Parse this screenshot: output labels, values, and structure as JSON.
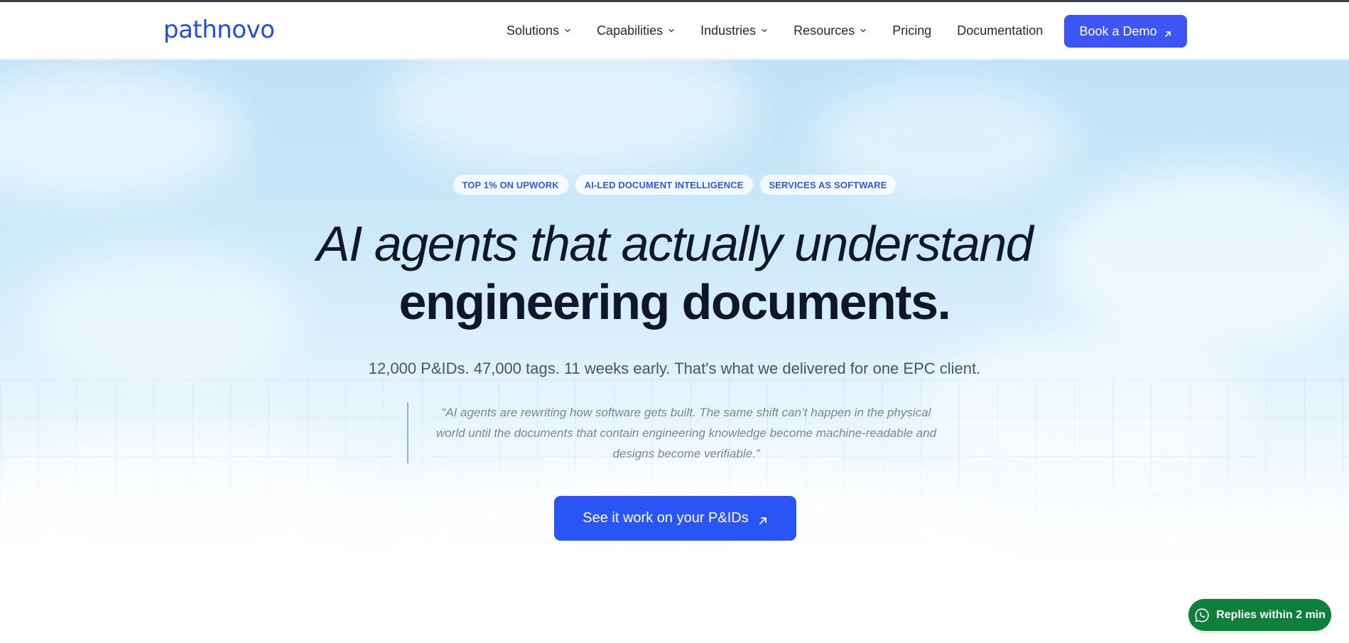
{
  "brand": {
    "logo_text": "pathnovo",
    "accent": "#3e55f5",
    "cta_color": "#2a55f5",
    "whatsapp_color": "#0f7f3c"
  },
  "nav": {
    "items": [
      {
        "label": "Solutions",
        "has_dropdown": true
      },
      {
        "label": "Capabilities",
        "has_dropdown": true
      },
      {
        "label": "Industries",
        "has_dropdown": true
      },
      {
        "label": "Resources",
        "has_dropdown": true
      },
      {
        "label": "Pricing",
        "has_dropdown": false
      },
      {
        "label": "Documentation",
        "has_dropdown": false
      }
    ],
    "demo_button": {
      "label": "Book a Demo",
      "icon": "arrow-up-right-icon"
    }
  },
  "hero": {
    "badges": [
      "TOP 1% ON UPWORK",
      "AI-LED DOCUMENT INTELLIGENCE",
      "SERVICES AS SOFTWARE"
    ],
    "headline_line1": "AI agents that actually understand",
    "headline_line2": "engineering documents.",
    "subtitle": "12,000 P&IDs. 47,000 tags. 11 weeks early. That's what we delivered for one EPC client.",
    "quote": "“AI agents are rewriting how software gets built. The same shift can’t happen in the physical world until the documents that contain engineering knowledge become machine-readable and designs become verifiable.”",
    "cta": {
      "label": "See it work on your P&IDs",
      "icon": "arrow-up-right-icon"
    }
  },
  "whatsapp": {
    "label": "Replies within 2 min",
    "icon": "whatsapp-icon"
  }
}
